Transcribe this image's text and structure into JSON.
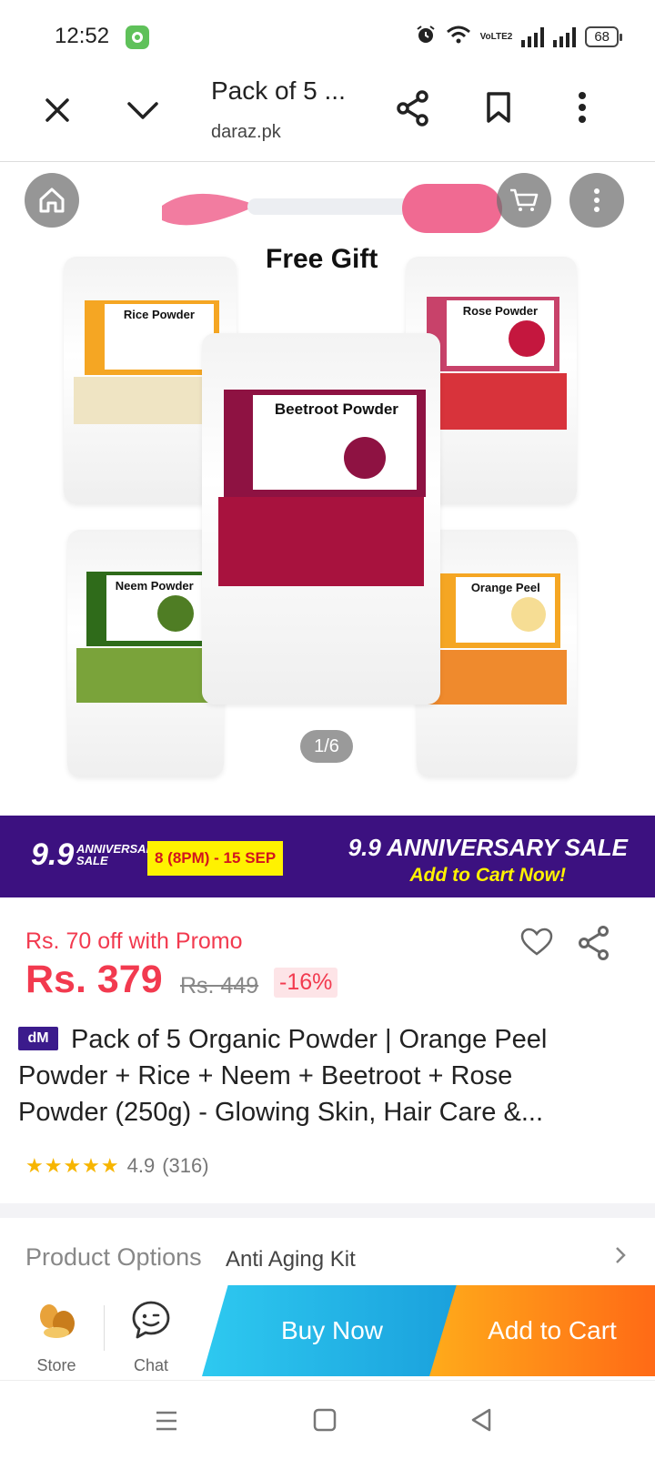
{
  "status_bar": {
    "time": "12:52",
    "battery": "68",
    "volte": "VoLTE2"
  },
  "browser": {
    "tab_title": "Pack of 5 ...",
    "url": "daraz.pk"
  },
  "hero": {
    "free_gift": "Free Gift",
    "counter": "1/6",
    "pouches": [
      {
        "name": "Rice Powder",
        "label_color": "#f5a623",
        "fill_color": "#efe4c3"
      },
      {
        "name": "Rose Powder",
        "label_color": "#c8426a",
        "fill_color": "#d8333b"
      },
      {
        "name": "Beetroot Powder",
        "label_color": "#8e1242",
        "fill_color": "#a8123e"
      },
      {
        "name": "Neem Powder",
        "label_color": "#2f6b1a",
        "fill_color": "#7aa33a"
      },
      {
        "name": "Orange Peel",
        "label_color": "#f5a623",
        "fill_color": "#ef8a2d"
      }
    ]
  },
  "banner": {
    "logo_number": "9.9",
    "logo_text": "ANNIVERSARY SALE",
    "dates": "8 (8PM) - 15 SEP",
    "title": "9.9 ANNIVERSARY SALE",
    "subtitle": "Add to Cart Now!"
  },
  "price": {
    "promo": "Rs. 70 off with Promo",
    "current": "Rs. 379",
    "original": "Rs. 449",
    "discount": "-16%"
  },
  "product": {
    "badge": "dM",
    "title": "Pack of 5 Organic Powder | Orange Peel Powder + Rice + Neem + Beetroot + Rose Powder (250g) - Glowing Skin, Hair Care &...",
    "rating_value": "4.9",
    "rating_count": "(316)"
  },
  "options": {
    "label": "Product Options",
    "value": "Anti Aging Kit"
  },
  "action_bar": {
    "store": "Store",
    "chat": "Chat",
    "buy_now": "Buy Now",
    "add_to_cart": "Add to Cart"
  },
  "colors": {
    "accent": "#f23a4f",
    "banner_bg": "#3c1180",
    "buy_now": "#1aa0dc",
    "add_to_cart": "#ff6a16"
  }
}
